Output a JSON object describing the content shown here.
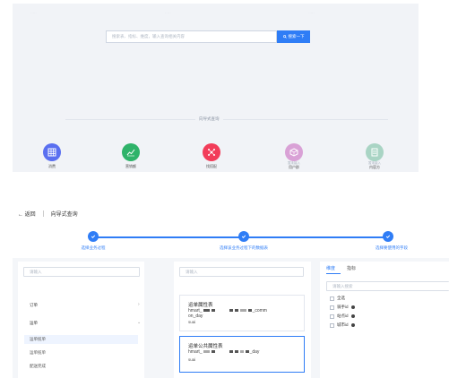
{
  "top": {
    "search_placeholder": "搜索表、指标、维度，输入查询相关内容",
    "search_button": "搜索一下",
    "guided_label": "向导式查询",
    "categories": [
      {
        "label": "消费",
        "sub": "",
        "color": "#5a6ff0",
        "icon": "table-grid-icon"
      },
      {
        "label": "营销额",
        "sub": "",
        "color": "#2fb36a",
        "icon": "trend-chart-icon"
      },
      {
        "label": "找搭配",
        "sub": "",
        "color": "#f23d5a",
        "icon": "network-icon"
      },
      {
        "label": "用户群",
        "sub": "暂未接入",
        "color": "#d9a1d6",
        "icon": "cube-icon"
      },
      {
        "label": "内容方",
        "sub": "暂未接入",
        "color": "#a9d4c4",
        "icon": "document-icon"
      }
    ]
  },
  "wizard": {
    "back_label": "← 返回",
    "title": "向导式查询",
    "steps": [
      "选择业务过程",
      "选择该业务过程下的数据表",
      "选择要使用的字段"
    ],
    "left": {
      "search_placeholder": "请输入",
      "items": [
        {
          "label": "订单",
          "chev": "›"
        },
        {
          "label": "运单",
          "chev": "⌄"
        }
      ],
      "subitems": [
        "运单揽单",
        "运单揽单",
        "配送完成"
      ]
    },
    "middle": {
      "search_placeholder": "请输入",
      "cards": [
        {
          "name": "运单属性表",
          "code_start": "hmart_",
          "code_end": "_comm",
          "code_wrap": "on_day",
          "ver": "suai"
        },
        {
          "name": "运单公共属性表",
          "code_start": "hmart_",
          "code_end": "_day",
          "code_wrap": "",
          "ver": "suai"
        }
      ]
    },
    "right": {
      "tabs": [
        "维度",
        "指标"
      ],
      "search_placeholder": "请输入搜索",
      "checkboxes": [
        "全选",
        "骑手id",
        "站点id",
        "城市id"
      ]
    }
  },
  "colors": {
    "accent": "#2f7df6"
  }
}
